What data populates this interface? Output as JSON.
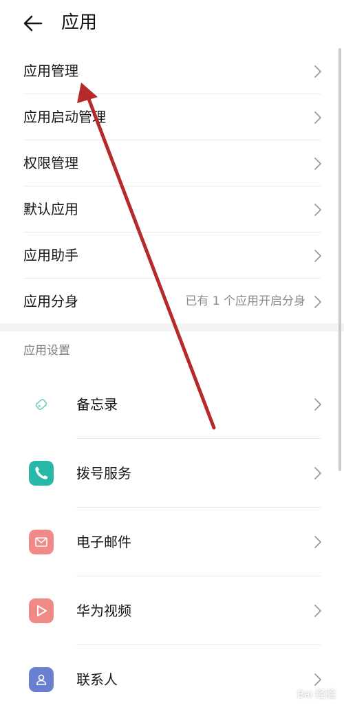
{
  "header": {
    "title": "应用"
  },
  "menu": [
    {
      "label": "应用管理",
      "value": ""
    },
    {
      "label": "应用启动管理",
      "value": ""
    },
    {
      "label": "权限管理",
      "value": ""
    },
    {
      "label": "默认应用",
      "value": ""
    },
    {
      "label": "应用助手",
      "value": ""
    },
    {
      "label": "应用分身",
      "value": "已有 1 个应用开启分身"
    }
  ],
  "section": {
    "title": "应用设置"
  },
  "apps": [
    {
      "label": "备忘录",
      "icon": "memo-icon",
      "color": "#ffffff"
    },
    {
      "label": "拨号服务",
      "icon": "phone-icon",
      "color": "#27b8a9"
    },
    {
      "label": "电子邮件",
      "icon": "mail-icon",
      "color": "#ef8a86"
    },
    {
      "label": "华为视频",
      "icon": "video-icon",
      "color": "#ef8a86"
    },
    {
      "label": "联系人",
      "icon": "contacts-icon",
      "color": "#6a7fd0"
    }
  ],
  "annotation": {
    "arrow_color": "#b52a2a"
  },
  "watermark": {
    "text": "Bai 经验"
  }
}
